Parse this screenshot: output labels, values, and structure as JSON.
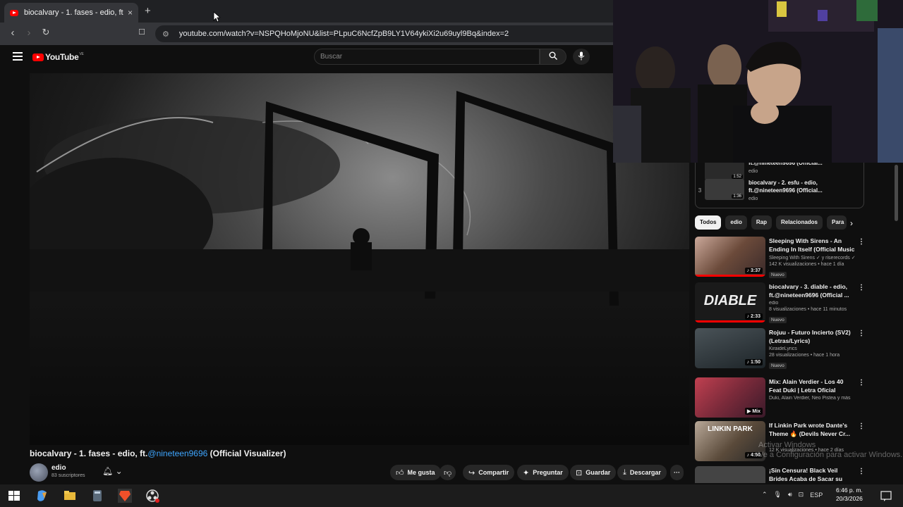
{
  "browser": {
    "tab_title": "biocalvary - 1. fases - edio, ft.@n",
    "tab_close": "×",
    "new_tab": "+",
    "url": "youtube.com/watch?v=NSPQHoMjoNU&list=PLpuC6NcfZpB9LY1V64ykiXi2u69uyl9Bq&index=2",
    "icons": {
      "back": "back-arrow-icon",
      "forward": "forward-arrow-icon",
      "reload": "reload-icon",
      "bookmark": "bookmark-icon",
      "site_info": "site-info-icon"
    }
  },
  "youtube": {
    "logo_text": "YouTube",
    "logo_region": "VE",
    "search_placeholder": "Buscar"
  },
  "video": {
    "title_prefix": "biocalvary - 1. fases - edio, ft.",
    "title_mention": "@nineteen9696",
    "title_suffix": " (Official Visualizer)",
    "channel": "edio",
    "subscribers": "83 suscriptores",
    "actions": {
      "like": "Me gusta",
      "share": "Compartir",
      "ask": "Preguntar",
      "save": "Guardar",
      "download": "Descargar",
      "more": "···"
    }
  },
  "playlist": {
    "items": [
      {
        "index": "",
        "title": "ft.@nineteen9696 (Official...",
        "channel": "edio",
        "duration": "1:52"
      },
      {
        "index": "3",
        "title": "biocalvary - 2. esfu - edio, ft.@nineteen9696 (Official...",
        "channel": "edio",
        "duration": "1:36"
      }
    ]
  },
  "chips": [
    "Todos",
    "edio",
    "Rap",
    "Relacionados",
    "Para"
  ],
  "recommendations": [
    {
      "title": "Sleeping With Sirens - An Ending In Itself (Official Music ...",
      "channel": "Sleeping With Sirens ✓ y riserecords ✓",
      "views": "142 K visualizaciones • hace 1 día",
      "badge": "Nuevo",
      "duration": "♪ 3:37",
      "thumb_color": "#6b4a3a"
    },
    {
      "title": "biocalvary - 3. diable - edio, ft.@nineteen9696 (Official ...",
      "channel": "edio",
      "views": "8 visualizaciones • hace 11 minutos",
      "badge": "Nuevo",
      "duration": "♪ 2:33",
      "thumb_color": "#1a1a1a"
    },
    {
      "title": "Rojuu - Futuro Incierto (SV2) (Letras/Lyrics)",
      "channel": "KiraideLyrics",
      "views": "28 visualizaciones • hace 1 hora",
      "badge": "Nuevo",
      "duration": "♪ 1:50",
      "thumb_color": "#2a3338"
    },
    {
      "title": "Mix: Alain Verdier - Los 40 Feat Duki | Letra Oficial",
      "channel": "Duki, Alain Verdier, Neo Pistea y más",
      "views": "",
      "badge": "",
      "duration": "▶ Mix",
      "thumb_color": "#7a2a3a"
    },
    {
      "title": "If Linkin Park wrote Dante's Theme 🔥 (Devils Never Cr...",
      "channel": "",
      "views": "12 K visualizaciones • hace 2 días",
      "badge": "",
      "duration": "♪ 4:50",
      "thumb_color": "#5a4a3a"
    },
    {
      "title": "¡Sin Censura! Black Veil Brides Acaba de Sacar su Cancion M...",
      "channel": "",
      "views": "",
      "badge": "",
      "duration": "",
      "thumb_color": "#444"
    }
  ],
  "overlay": {
    "watermark_line1": "Activar Windows",
    "watermark_line2": "Ve a Configuración para activar Windows."
  },
  "taskbar": {
    "lang": "ESP",
    "time": "6:46 p. m.",
    "date": "20/3/2026"
  }
}
